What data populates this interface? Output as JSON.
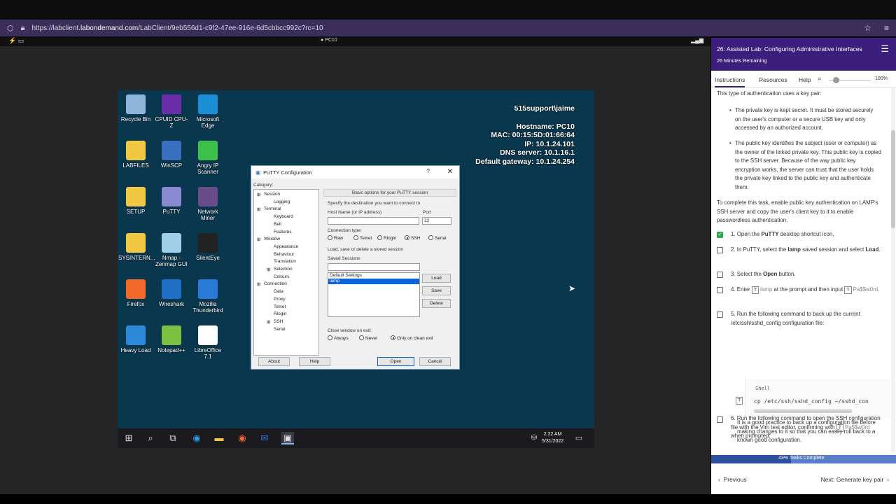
{
  "browser": {
    "url_prefix": "https://labclient.",
    "url_domain": "labondemand.com",
    "url_path": "/LabClient/9eb556d1-c9f2-47ee-916e-6d5cbbcc992c?rc=10"
  },
  "labbar": {
    "machine": "PC10"
  },
  "desktop": {
    "icons": [
      {
        "label": "Recycle Bin",
        "color": "#8fb4d9"
      },
      {
        "label": "CPUID CPU-Z",
        "color": "#6a2fa8"
      },
      {
        "label": "Microsoft Edge",
        "color": "#1b8fd6"
      },
      {
        "label": "LABFILES",
        "color": "#f2c744"
      },
      {
        "label": "WinSCP",
        "color": "#3a6fc0"
      },
      {
        "label": "Angry IP Scanner",
        "color": "#3cc24a"
      },
      {
        "label": "SETUP",
        "color": "#f2c744"
      },
      {
        "label": "PuTTY",
        "color": "#8a8ad0"
      },
      {
        "label": "Network Miner",
        "color": "#6a4c8c"
      },
      {
        "label": "SYSINTERN...",
        "color": "#f2c744"
      },
      {
        "label": "Nmap - Zenmap GUI",
        "color": "#9fd0e8"
      },
      {
        "label": "SilentEye",
        "color": "#222222"
      },
      {
        "label": "Firefox",
        "color": "#f2692a"
      },
      {
        "label": "Wireshark",
        "color": "#1f6fc5"
      },
      {
        "label": "Mozilla Thunderbird",
        "color": "#2a7bd8"
      },
      {
        "label": "Heavy Load",
        "color": "#2d8ad8"
      },
      {
        "label": "Notepad++",
        "color": "#7cc242"
      },
      {
        "label": "LibreOffice 7.1",
        "color": "#ffffff"
      }
    ],
    "sysinfo": {
      "user": "515support\\jaime",
      "hostname": "Hostname: PC10",
      "mac": "MAC: 00:15:5D:01:66:64",
      "ip": "IP: 10.1.24.101",
      "dns": "DNS server: 10.1.16.1",
      "gateway": "Default gateway: 10.1.24.254"
    },
    "clock": {
      "time": "2:22 AM",
      "date": "5/31/2022"
    }
  },
  "putty": {
    "title": "PuTTY Configuration",
    "category_label": "Category:",
    "tree": [
      "Session",
      "Logging",
      "Terminal",
      "Keyboard",
      "Bell",
      "Features",
      "Window",
      "Appearance",
      "Behaviour",
      "Translation",
      "Selection",
      "Colours",
      "Connection",
      "Data",
      "Proxy",
      "Telnet",
      "Rlogin",
      "SSH",
      "Serial"
    ],
    "header": "Basic options for your PuTTY session",
    "dest_label": "Specify the destination you want to connect to",
    "host_label": "Host Name (or IP address)",
    "port_label": "Port",
    "port_value": "22",
    "conn_type_label": "Connection type:",
    "conn_types": [
      "Raw",
      "Telnet",
      "Rlogin",
      "SSH",
      "Serial"
    ],
    "saved_label": "Load, save or delete a stored session",
    "saved_sessions_label": "Saved Sessions",
    "sessions": [
      "Default Settings",
      "lamp"
    ],
    "load": "Load",
    "save": "Save",
    "delete": "Delete",
    "close_label": "Close window on exit:",
    "close_opts": [
      "Always",
      "Never",
      "Only on clean exit"
    ],
    "about": "About",
    "help": "Help",
    "open": "Open",
    "cancel": "Cancel"
  },
  "panel": {
    "title": "26: Assisted Lab: Configuring Administrative Interfaces",
    "subtitle": "26 Minutes Remaining",
    "tabs": [
      "Instructions",
      "Resources",
      "Help"
    ],
    "zoom": "100%",
    "intro": "This type of authentication uses a key pair:",
    "bullet1": "The private key is kept secret. It must be stored securely on the user's computer or a secure USB key and only accessed by an authorized account.",
    "bullet2": "The public key identifies the subject (user or computer) as the owner of the linked private key. This public key is copied to the SSH server. Because of the way public key encryption works, the server can trust that the user holds the private key linked to the public key and authenticate them.",
    "task_intro": "To complete this task, enable public key authentication on LAMP's SSH server and copy the user's client key to it to enable passwordless authentication.",
    "steps": [
      {
        "n": "1.",
        "pre": "Open the ",
        "b": "PuTTY",
        "post": " desktop shortcut icon."
      },
      {
        "n": "2.",
        "pre": "In PuTTY, select the ",
        "b": "lamp",
        "post": " saved session and select ",
        "b2": "Load",
        "post2": "."
      },
      {
        "n": "3.",
        "pre": "Select the ",
        "b": "Open",
        "post": " button."
      },
      {
        "n": "4.",
        "pre": "Enter ",
        "code1": "lamp",
        "mid": " at the prompt and then input ",
        "code2": "Pa$$w0rd",
        "post": "."
      },
      {
        "n": "5.",
        "text": "Run the following command to back up the current /etc/ssh/sshd_config configuration file:"
      },
      {
        "n": "6.",
        "text": "Run the following command to open the SSH configuration file with the Vim text editor, confirming with ",
        "code": "Pa$$w0rd",
        "post": " when prompted:"
      }
    ],
    "code_lang": "Shell",
    "code_cmd": "cp /etc/ssh/sshd_config ~/sshd_con",
    "backup_note": "It is a good practice to back up a configuration file before making changes to it so that you can easily roll back to a known good configuration.",
    "progress_pct": 0.43,
    "progress_label": "43% Tasks Complete",
    "prev": "Previous",
    "next": "Next: Generate key pair"
  }
}
